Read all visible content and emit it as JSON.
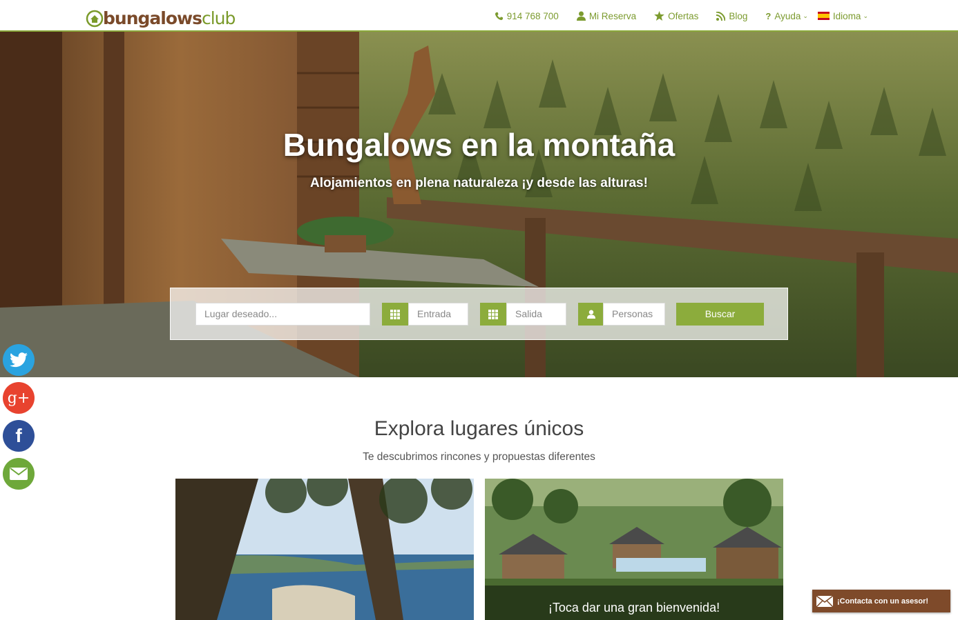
{
  "header": {
    "logo_bold": "bungalows",
    "logo_light": "club",
    "nav": [
      {
        "label": "914 768 700",
        "icon": "phone-icon"
      },
      {
        "label": "Mi Reserva",
        "icon": "user-icon"
      },
      {
        "label": "Ofertas",
        "icon": "star-icon"
      },
      {
        "label": "Blog",
        "icon": "rss-icon"
      },
      {
        "label": "Ayuda",
        "icon": "question-icon"
      },
      {
        "label": "Idioma",
        "icon": "spain-flag-icon"
      }
    ]
  },
  "hero": {
    "title": "Bungalows en la montaña",
    "subtitle": "Alojamientos en plena naturaleza ¡y desde las alturas!"
  },
  "search": {
    "place_placeholder": "Lugar deseado...",
    "checkin_placeholder": "Entrada",
    "checkout_placeholder": "Salida",
    "people_placeholder": "Personas",
    "button": "Buscar"
  },
  "social": [
    "twitter-icon",
    "google-plus-icon",
    "facebook-icon",
    "email-icon"
  ],
  "explore": {
    "title": "Explora lugares únicos",
    "subtitle": "Te descubrimos rincones y propuestas diferentes",
    "cards": [
      {
        "caption": ""
      },
      {
        "caption": "¡Toca dar una gran bienvenida!"
      }
    ]
  },
  "contact": {
    "label": "¡Contacta con un asesor!"
  },
  "colors": {
    "brand_green": "#8cac3c",
    "brand_brown": "#7e4a2a"
  }
}
